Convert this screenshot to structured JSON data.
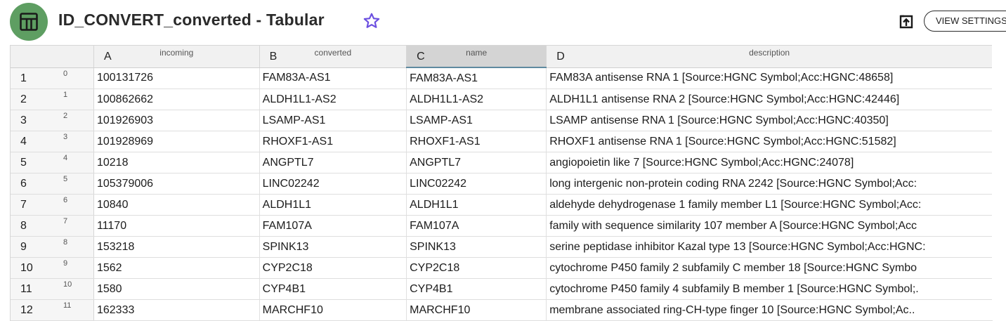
{
  "header": {
    "title": "ID_CONVERT_converted - Tabular",
    "view_settings_label": "VIEW SETTINGS",
    "icons": {
      "app": "table-icon",
      "favorite": "star-icon",
      "export": "export-icon"
    },
    "colors": {
      "app_icon_bg": "#5e9e62",
      "star": "#6b4fe0"
    }
  },
  "grid": {
    "corner": "",
    "columns": [
      {
        "letter": "A",
        "name": "incoming"
      },
      {
        "letter": "B",
        "name": "converted"
      },
      {
        "letter": "C",
        "name": "name"
      },
      {
        "letter": "D",
        "name": "description"
      }
    ],
    "rows": [
      {
        "num": "1",
        "index": "0",
        "cells": [
          "100131726",
          "FAM83A-AS1",
          "FAM83A-AS1",
          "FAM83A antisense RNA 1 [Source:HGNC Symbol;Acc:HGNC:48658]"
        ]
      },
      {
        "num": "2",
        "index": "1",
        "cells": [
          "100862662",
          "ALDH1L1-AS2",
          "ALDH1L1-AS2",
          "ALDH1L1 antisense RNA 2 [Source:HGNC Symbol;Acc:HGNC:42446]"
        ]
      },
      {
        "num": "3",
        "index": "2",
        "cells": [
          "101926903",
          "LSAMP-AS1",
          "LSAMP-AS1",
          "LSAMP antisense RNA 1 [Source:HGNC Symbol;Acc:HGNC:40350]"
        ]
      },
      {
        "num": "4",
        "index": "3",
        "cells": [
          "101928969",
          "RHOXF1-AS1",
          "RHOXF1-AS1",
          "RHOXF1 antisense RNA 1 [Source:HGNC Symbol;Acc:HGNC:51582]"
        ]
      },
      {
        "num": "5",
        "index": "4",
        "cells": [
          "10218",
          "ANGPTL7",
          "ANGPTL7",
          "angiopoietin like 7 [Source:HGNC Symbol;Acc:HGNC:24078]"
        ]
      },
      {
        "num": "6",
        "index": "5",
        "cells": [
          "105379006",
          "LINC02242",
          "LINC02242",
          "long intergenic non-protein coding RNA 2242 [Source:HGNC Symbol;Acc:"
        ]
      },
      {
        "num": "7",
        "index": "6",
        "cells": [
          "10840",
          "ALDH1L1",
          "ALDH1L1",
          "aldehyde dehydrogenase 1 family member L1 [Source:HGNC Symbol;Acc:"
        ]
      },
      {
        "num": "8",
        "index": "7",
        "cells": [
          "11170",
          "FAM107A",
          "FAM107A",
          "family with sequence similarity 107 member A [Source:HGNC Symbol;Acc"
        ]
      },
      {
        "num": "9",
        "index": "8",
        "cells": [
          "153218",
          "SPINK13",
          "SPINK13",
          "serine peptidase inhibitor Kazal type 13 [Source:HGNC Symbol;Acc:HGNC:"
        ]
      },
      {
        "num": "10",
        "index": "9",
        "cells": [
          "1562",
          "CYP2C18",
          "CYP2C18",
          "cytochrome P450 family 2 subfamily C member 18 [Source:HGNC Symbo"
        ]
      },
      {
        "num": "11",
        "index": "10",
        "cells": [
          "1580",
          "CYP4B1",
          "CYP4B1",
          "cytochrome P450 family 4 subfamily B member 1 [Source:HGNC Symbol;."
        ]
      },
      {
        "num": "12",
        "index": "11",
        "cells": [
          "162333",
          "MARCHF10",
          "MARCHF10",
          "membrane associated ring-CH-type finger 10 [Source:HGNC Symbol;Ac.."
        ]
      }
    ]
  }
}
